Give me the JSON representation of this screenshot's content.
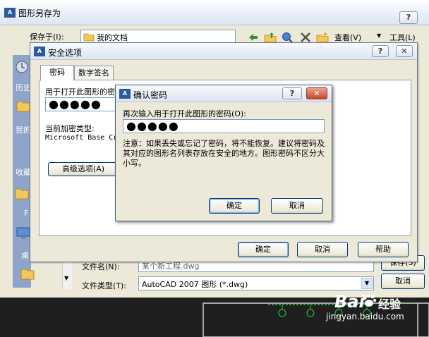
{
  "save_as": {
    "title": "图形另存为",
    "save_in_label": "保存于(I):",
    "save_in_value": "我的文档",
    "view_label": "查看(V)",
    "tools_label": "工具(L)",
    "places": [
      "历史",
      "我的",
      "收藏",
      "桌"
    ],
    "filename_label": "文件名(N):",
    "filename_value": "某个新工程.dwg",
    "filetype_label": "文件类型(T):",
    "filetype_value": "AutoCAD 2007 图形 (*.dwg)",
    "save_button": "保存(S)",
    "cancel_button": "取消",
    "help_button": "?",
    "close_button": "✕"
  },
  "security": {
    "title": "安全选项",
    "help_button": "?",
    "close_button": "✕",
    "tabs": [
      "密码",
      "数字签名"
    ],
    "open_password_label": "用于打开此图形的密",
    "password_mask": "●●●●●",
    "encryption_type_label": "当前加密类型:",
    "encryption_type_value": "Microsoft Base Cr",
    "advanced_button": "高级选项(A)",
    "ok_button": "确定",
    "cancel_button": "取消",
    "help_text_button": "帮助"
  },
  "confirm": {
    "title": "确认密码",
    "help_button": "?",
    "close_button": "✕",
    "prompt": "再次输入用于打开此图形的密码(O):",
    "password_mask": "●●●●●",
    "note": "注意：如果丢失或忘记了密码，将不能恢复。建议将密码及其对应的图形名列表存放在安全的地方。图形密码不区分大小写。",
    "ok_button": "确定",
    "cancel_button": "取消"
  },
  "watermark": {
    "brand": "Bai",
    "brand_suffix": "经验",
    "url": "jingyan.baidu.com"
  },
  "colors": {
    "xp_face": "#ece9d8",
    "title_gradient_top": "#f7f9fc",
    "close_red": "#c8462b",
    "places_bar": "#8ea4c8",
    "dark_strip": "#1f1f1f"
  }
}
